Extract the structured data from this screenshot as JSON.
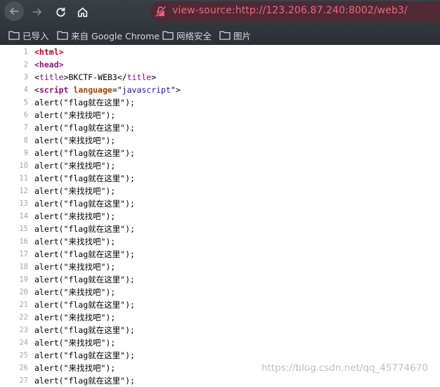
{
  "browser": {
    "address": "view-source:http://123.206.87.240:8002/web3/",
    "icons": [
      "back-arrow-icon",
      "forward-arrow-icon",
      "reload-icon",
      "home-icon",
      "not-secure-icon",
      "folder-icon"
    ],
    "accent_color": "#f0647e"
  },
  "bookmarks": [
    {
      "label": "已导入"
    },
    {
      "label": "来自 Google Chrome"
    },
    {
      "label": "网络安全"
    },
    {
      "label": "图片"
    }
  ],
  "source": {
    "header": [
      {
        "num": "1",
        "parts": [
          {
            "t": "<html>",
            "c": "tag html"
          }
        ]
      },
      {
        "num": "2",
        "parts": [
          {
            "t": "<head>",
            "c": "tag"
          }
        ]
      },
      {
        "num": "3",
        "parts": [
          {
            "t": "<",
            "c": ""
          },
          {
            "t": "title",
            "c": "tagname-title"
          },
          {
            "t": ">BKCTF-WEB3</",
            "c": ""
          },
          {
            "t": "title",
            "c": "tagname-title"
          },
          {
            "t": ">",
            "c": ""
          }
        ]
      },
      {
        "num": "4",
        "parts": [
          {
            "t": "<",
            "c": ""
          },
          {
            "t": "script",
            "c": "tag"
          },
          {
            "t": " ",
            "c": ""
          },
          {
            "t": "language",
            "c": "attr"
          },
          {
            "t": "=\"",
            "c": ""
          },
          {
            "t": "javascript",
            "c": "aval"
          },
          {
            "t": "\">",
            "c": ""
          }
        ]
      }
    ],
    "alerts": [
      {
        "num": "5",
        "text": "alert(\"flag就在这里\");"
      },
      {
        "num": "6",
        "text": "alert(\"来找找吧\");"
      },
      {
        "num": "7",
        "text": "alert(\"flag就在这里\");"
      },
      {
        "num": "8",
        "text": "alert(\"来找找吧\");"
      },
      {
        "num": "9",
        "text": "alert(\"flag就在这里\");"
      },
      {
        "num": "10",
        "text": "alert(\"来找找吧\");"
      },
      {
        "num": "11",
        "text": "alert(\"flag就在这里\");"
      },
      {
        "num": "12",
        "text": "alert(\"来找找吧\");"
      },
      {
        "num": "13",
        "text": "alert(\"flag就在这里\");"
      },
      {
        "num": "14",
        "text": "alert(\"来找找吧\");"
      },
      {
        "num": "15",
        "text": "alert(\"flag就在这里\");"
      },
      {
        "num": "16",
        "text": "alert(\"来找找吧\");"
      },
      {
        "num": "17",
        "text": "alert(\"flag就在这里\");"
      },
      {
        "num": "18",
        "text": "alert(\"来找找吧\");"
      },
      {
        "num": "19",
        "text": "alert(\"flag就在这里\");"
      },
      {
        "num": "20",
        "text": "alert(\"来找找吧\");"
      },
      {
        "num": "21",
        "text": "alert(\"flag就在这里\");"
      },
      {
        "num": "22",
        "text": "alert(\"来找找吧\");"
      },
      {
        "num": "23",
        "text": "alert(\"flag就在这里\");"
      },
      {
        "num": "24",
        "text": "alert(\"来找找吧\");"
      },
      {
        "num": "25",
        "text": "alert(\"flag就在这里\");"
      },
      {
        "num": "26",
        "text": "alert(\"来找找吧\");"
      },
      {
        "num": "27",
        "text": "alert(\"flag就在这里\");"
      }
    ]
  },
  "watermark": "https://blog.csdn.net/qq_45774670"
}
